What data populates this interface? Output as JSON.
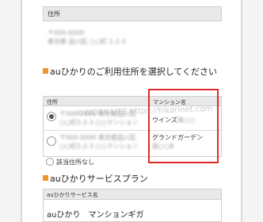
{
  "address_label": "住所",
  "address_lines": [
    "〒000-0000",
    "東京都 品川区 ○○町 1-2-3"
  ],
  "select_section_title": "auひかりのご利用住所を選択してください",
  "table": {
    "col_address": "住所",
    "col_mansion": "マンション名",
    "rows": [
      {
        "address_1": "〒000-0000 東京都品川区",
        "address_2": "○○町1-2-3 ○○マンション",
        "mansion_main": "ウインズ",
        "mansion_blur": "南○○",
        "checked": true
      },
      {
        "address_1": "〒000-0000 東京都品川区",
        "address_2": "○○町1-2-3 ○○マンション",
        "mansion_main": "グランドガーデン",
        "mansion_blur": "南○○B",
        "checked": false
      }
    ],
    "none_option": "該当住所なし"
  },
  "plan_section_title": "auひかりサービスプラン",
  "plan": {
    "header": "auひかりサービス名",
    "value": "auひかり　マンションギガ"
  },
  "watermark": "©WORK-LIFE   https://hikarinet.com"
}
